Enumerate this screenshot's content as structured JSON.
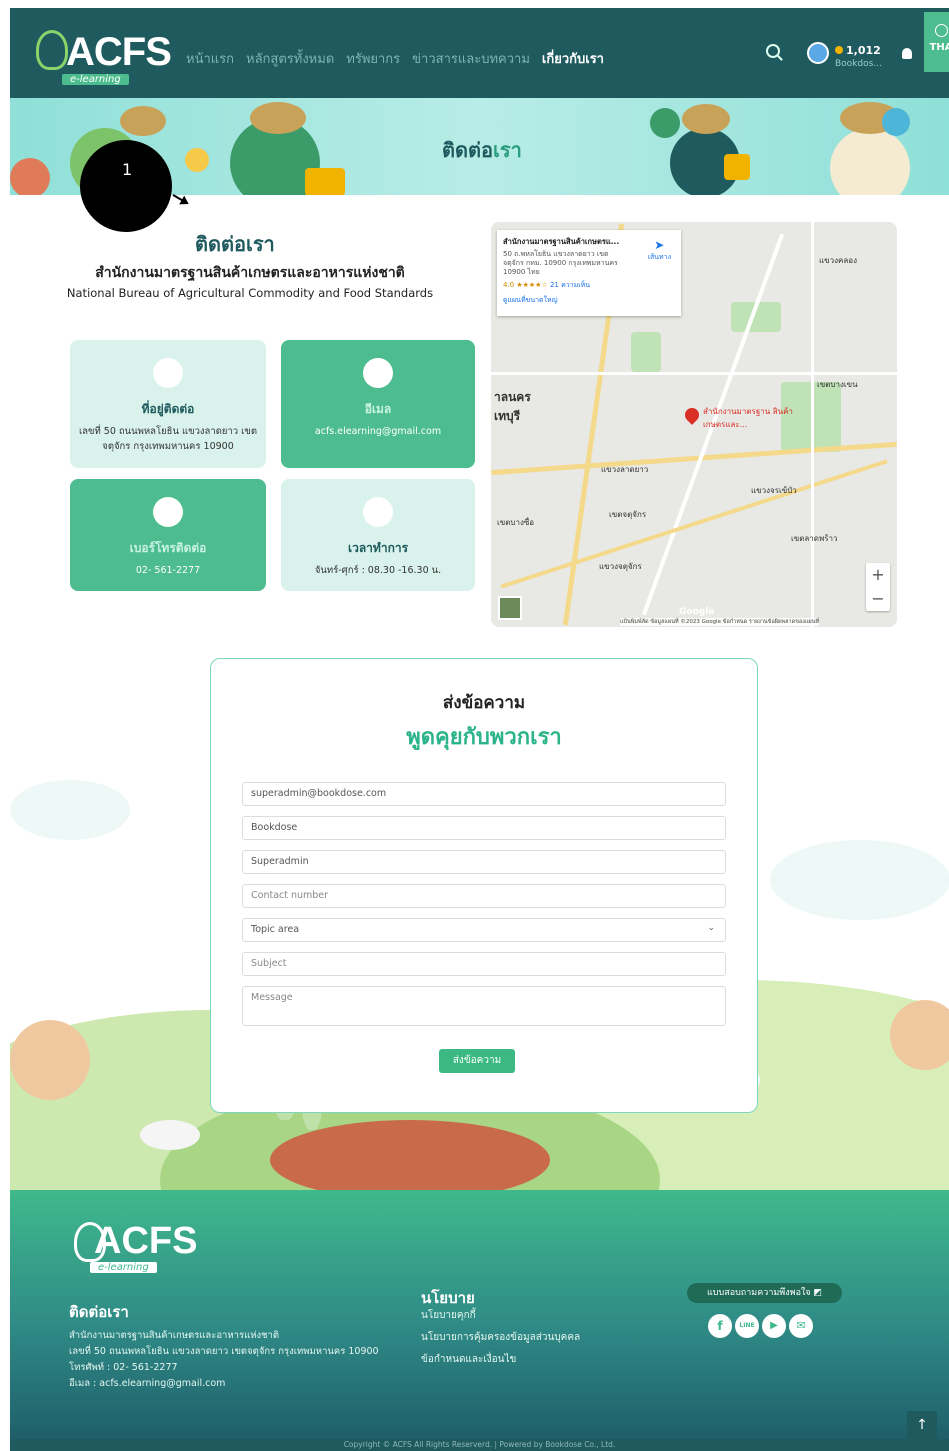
{
  "header": {
    "logo_text": "ACFS",
    "logo_sub": "e-learning",
    "nav": [
      "หน้าแรก",
      "หลักสูตรทั้งหมด",
      "ทรัพยากร",
      "ข่าวสารและบทความ",
      "เกี่ยวกับเรา"
    ],
    "active_nav": "เกี่ยวกับเรา",
    "coins": "1,012",
    "username": "Bookdos...",
    "lang": "THA"
  },
  "banner": {
    "title_a": "ติดต่อ",
    "title_b": "เรา"
  },
  "step_marker": "1",
  "contact": {
    "title": "ติดต่อเรา",
    "org_th": "สำนักงานมาตรฐานสินค้าเกษตรและอาหารแห่งชาติ",
    "org_en": "National Bureau of Agricultural Commodity and Food Standards",
    "cards": [
      {
        "label": "ที่อยู่ติดต่อ",
        "value": "เลขที่ 50 ถนนพหลโยธิน แขวงลาดยาว เขตจตุจักร กรุงเทพมหานคร 10900",
        "icon": "location-pin-icon"
      },
      {
        "label": "อีเมล",
        "value": "acfs.elearning@gmail.com",
        "icon": "envelope-icon"
      },
      {
        "label": "เบอร์โทรติดต่อ",
        "value": "02- 561-2277",
        "icon": "phone-icon"
      },
      {
        "label": "เวลาทำการ",
        "value": "จันทร์-ศุกร์ : 08.30 -16.30 น.",
        "icon": "clock-icon"
      }
    ]
  },
  "map": {
    "place_name": "สำนักงานมาตรฐานสินค้าเกษตรแ...",
    "address": "50 ถ.พหลโยธิน แขวงลาดยาว เขตจตุจักร กทม. 10900 กรุงเทพมหานคร 10900 ไทย",
    "rating": "4.0 ★★★★☆",
    "reviews": "21 ความเห็น",
    "larger_map": "ดูแผนที่ขนาดใหญ่",
    "directions": "เส้นทาง",
    "pin_label": "สำนักงานมาตรฐาน สินค้าเกษตรและ...",
    "footer": "แป้นพิมพ์ลัด  ข้อมูลแผนที่ ©2023 Google  ข้อกำหนด  รายงานข้อผิดพลาดของแผนที่",
    "zoom_in": "+",
    "zoom_out": "−",
    "google": "Google"
  },
  "form": {
    "subtitle": "ส่งข้อความ",
    "title": "พูดคุยกับพวกเรา",
    "email": "superadmin@bookdose.com",
    "first_name": "Bookdose",
    "last_name": "Superadmin",
    "contact_number": "Contact number",
    "topic": "Topic area",
    "subject": "Subject",
    "message": "Message",
    "submit": "ส่งข้อความ"
  },
  "footer": {
    "logo_text": "ACFS",
    "logo_sub": "e-learning",
    "contact_title": "ติดต่อเรา",
    "lines": [
      "สำนักงานมาตรฐานสินค้าเกษตรและอาหารแห่งชาติ",
      "เลขที่ 50 ถนนพหลโยธิน แขวงลาดยาว เขตจตุจักร กรุงเทพมหานคร 10900",
      "โทรศัพท์ : 02- 561-2277",
      "อีเมล : acfs.elearning@gmail.com"
    ],
    "policy_title": "นโยบาย",
    "policies": [
      "นโยบายคุกกี้",
      "นโยบายการคุ้มครองข้อมูลส่วนบุคคล",
      "ข้อกำหนดและเงื่อนไข"
    ],
    "survey": "แบบสอบถามความพึงพอใจ",
    "social": [
      "f",
      "LINE",
      "▶",
      "✉"
    ],
    "copyright": "Copyright © ACFS All Rights Reserverd. | Powered by Bookdose Co., Ltd.",
    "to_top": "↑"
  },
  "colors": {
    "header": "#1e5a5e",
    "accent": "#4dbd8f",
    "light_card": "#d9f2ec"
  }
}
